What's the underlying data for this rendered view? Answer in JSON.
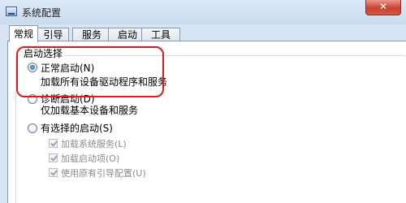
{
  "window": {
    "title": "系统配置",
    "close_glyph": "✕"
  },
  "tabs": [
    {
      "label": "常规",
      "active": true
    },
    {
      "label": "引导",
      "active": false
    },
    {
      "label": "服务",
      "active": false
    },
    {
      "label": "启动",
      "active": false
    },
    {
      "label": "工具",
      "active": false
    }
  ],
  "startup_selection": {
    "legend": "启动选择",
    "options": [
      {
        "label": "正常启动(N)",
        "description": "加载所有设备驱动程序和服务",
        "checked": true
      },
      {
        "label": "诊断启动(D)",
        "description": "仅加载基本设备和服务",
        "checked": false
      },
      {
        "label": "有选择的启动(S)",
        "checked": false
      }
    ],
    "selective_items": [
      {
        "label": "加载系统服务(L)",
        "checked": true
      },
      {
        "label": "加载启动项(O)",
        "checked": true
      },
      {
        "label": "使用原有引导配置(U)",
        "checked": true
      }
    ]
  },
  "colors": {
    "highlight": "#e0181d",
    "window_bg": "#d6e4f3",
    "close_button": "#c8432f"
  }
}
